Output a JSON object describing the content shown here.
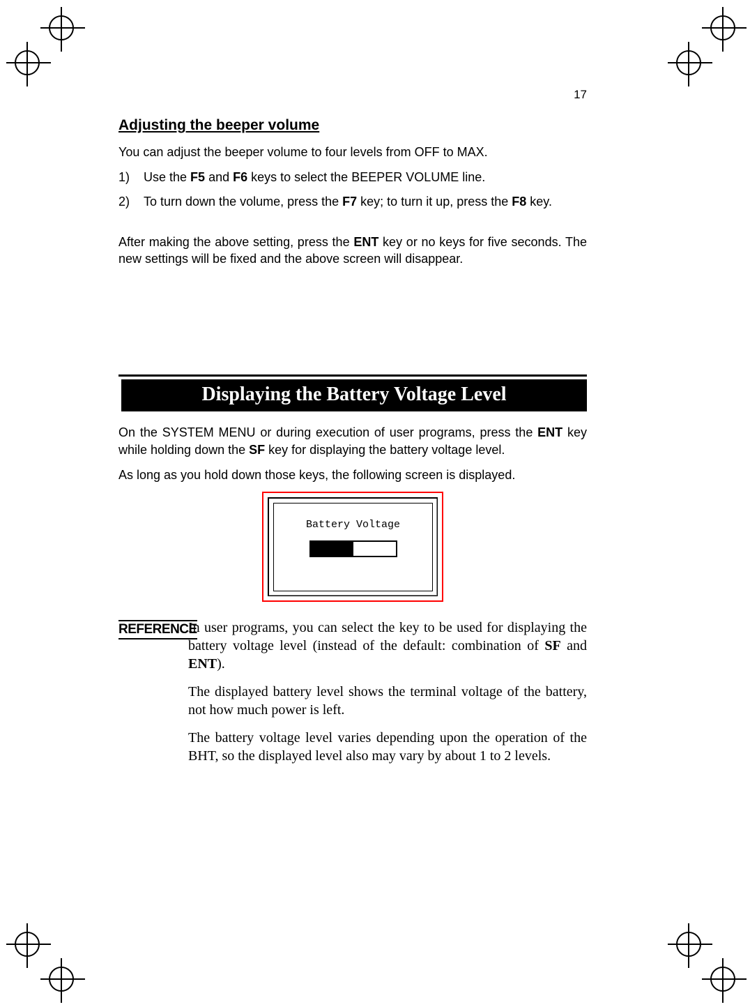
{
  "page_number": "17",
  "section1": {
    "heading": "Adjusting the beeper volume",
    "intro": "You can adjust the beeper volume to four levels from OFF to MAX.",
    "steps": [
      {
        "num": "1)",
        "pre": "Use the ",
        "k1": "F5",
        "mid1": " and ",
        "k2": "F6",
        "post": " keys to select the BEEPER VOLUME line."
      },
      {
        "num": "2)",
        "pre": "To turn down the volume, press the ",
        "k1": "F7",
        "mid1": " key; to turn it up, press the ",
        "k2": "F8",
        "post": " key."
      }
    ],
    "after_pre": "After making the above setting, press the ",
    "after_k": "ENT",
    "after_post": " key or no keys for five seconds. The new settings will be fixed and the above screen will disappear."
  },
  "section2": {
    "banner": "Displaying the Battery Voltage Level",
    "p1_pre": "On the SYSTEM MENU or during execution of user programs, press the ",
    "p1_k1": "ENT",
    "p1_mid": " key while holding down the ",
    "p1_k2": "SF",
    "p1_post": " key for displaying the battery voltage level.",
    "p2": "As long as you hold down those keys, the following screen is displayed.",
    "screen_label": "Battery Voltage"
  },
  "reference": {
    "label": "REFERENCE",
    "p1_pre": "In user programs, you can select the key to be used for displaying the battery voltage level (instead of the default: combination of ",
    "p1_k1": "SF",
    "p1_mid": " and ",
    "p1_k2": "ENT",
    "p1_post": ").",
    "p2": "The displayed battery level shows the terminal voltage of the battery, not how much power is left.",
    "p3": "The battery voltage level varies depending upon the operation of the BHT, so the displayed level also may vary by about 1 to 2 levels."
  }
}
